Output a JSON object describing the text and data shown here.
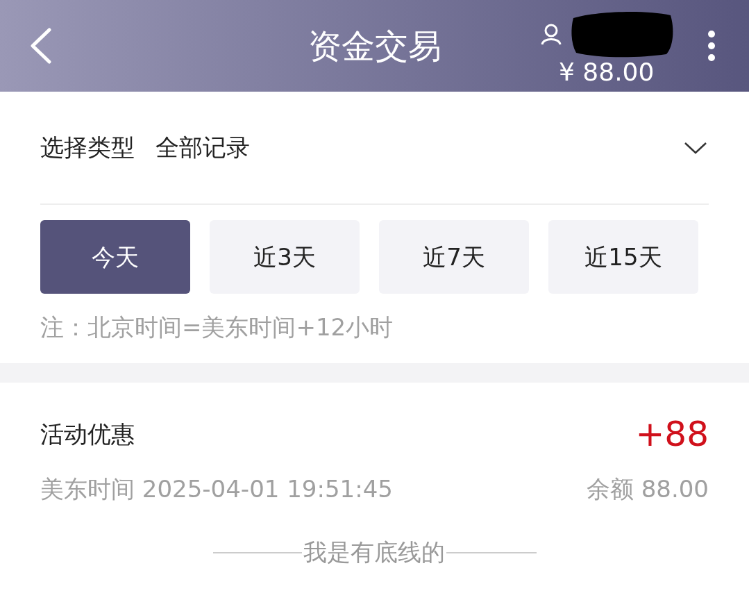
{
  "header": {
    "title": "资金交易",
    "balance": "¥ 88.00"
  },
  "filter": {
    "label": "选择类型",
    "value": "全部记录"
  },
  "ranges": [
    {
      "label": "今天",
      "selected": true
    },
    {
      "label": "近3天",
      "selected": false
    },
    {
      "label": "近7天",
      "selected": false
    },
    {
      "label": "近15天",
      "selected": false
    }
  ],
  "note": "注：北京时间=美东时间+12小时",
  "records": [
    {
      "title": "活动优惠",
      "amount": "+88",
      "time": "美东时间 2025-04-01 19:51:45",
      "balance": "余额 88.00"
    }
  ],
  "footer": "我是有底线的"
}
